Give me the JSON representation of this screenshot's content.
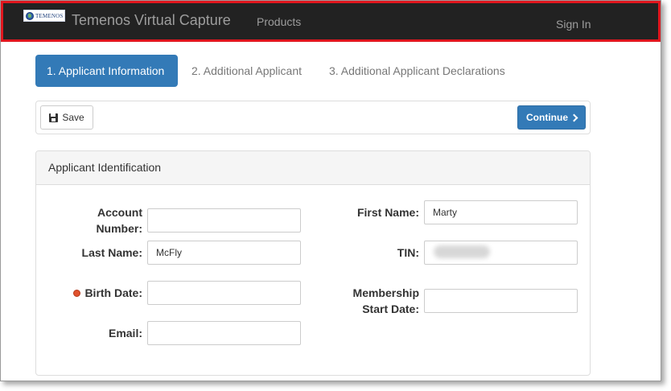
{
  "navbar": {
    "logo_text": "TEMENOS",
    "brand_title": "Temenos Virtual Capture",
    "products_link": "Products",
    "signin_link": "Sign In"
  },
  "steps": [
    {
      "label": "1. Applicant Information",
      "active": true
    },
    {
      "label": "2. Additional Applicant",
      "active": false
    },
    {
      "label": "3. Additional Applicant Declarations",
      "active": false
    }
  ],
  "toolbar": {
    "save_label": "Save",
    "continue_label": "Continue"
  },
  "panel": {
    "title": "Applicant Identification",
    "fields": {
      "account_number": {
        "label_line1": "Account",
        "label_line2": "Number:",
        "value": ""
      },
      "first_name": {
        "label": "First Name:",
        "value": "Marty"
      },
      "last_name": {
        "label": "Last Name:",
        "value": "McFly"
      },
      "tin": {
        "label": "TIN:",
        "value": ""
      },
      "birth_date": {
        "label": "Birth Date:",
        "value": "",
        "required": true
      },
      "membership_start_date": {
        "label_line1": "Membership",
        "label_line2": "Start Date:",
        "value": ""
      },
      "email": {
        "label": "Email:",
        "value": ""
      }
    }
  },
  "colors": {
    "navbar_bg": "#222222",
    "highlight_border": "#e0161e",
    "primary": "#337ab7",
    "required_indicator": "#e0522d"
  }
}
